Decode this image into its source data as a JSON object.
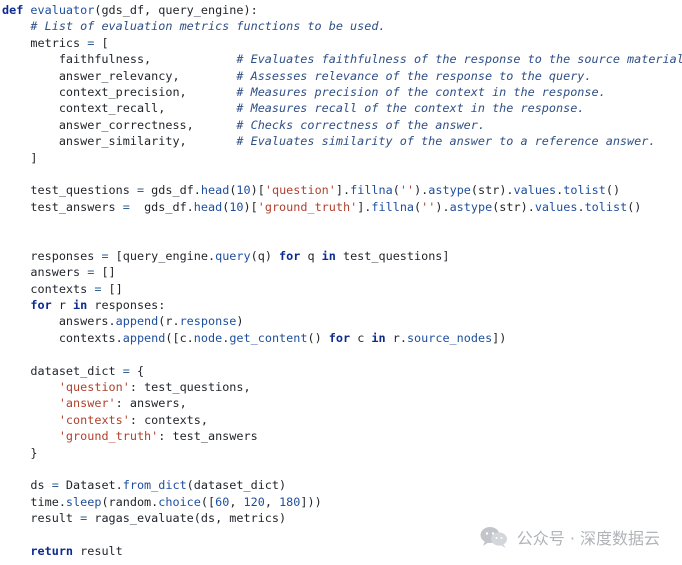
{
  "editor": {
    "lines": [
      [
        {
          "t": "def",
          "c": "kw"
        },
        {
          "t": " "
        },
        {
          "t": "evaluator",
          "c": "fn"
        },
        {
          "t": "(gds_df, query_engine):"
        }
      ],
      [
        {
          "t": "    "
        },
        {
          "t": "# List of evaluation metrics functions to be used.",
          "c": "cm"
        }
      ],
      [
        {
          "t": "    metrics "
        },
        {
          "t": "=",
          "c": "op"
        },
        {
          "t": " ["
        }
      ],
      [
        {
          "t": "        faithfulness,            "
        },
        {
          "t": "# Evaluates faithfulness of the response to the source material.",
          "c": "cm"
        }
      ],
      [
        {
          "t": "        answer_relevancy,        "
        },
        {
          "t": "# Assesses relevance of the response to the query.",
          "c": "cm"
        }
      ],
      [
        {
          "t": "        context_precision,       "
        },
        {
          "t": "# Measures precision of the context in the response.",
          "c": "cm"
        }
      ],
      [
        {
          "t": "        context_recall,          "
        },
        {
          "t": "# Measures recall of the context in the response.",
          "c": "cm"
        }
      ],
      [
        {
          "t": "        answer_correctness,      "
        },
        {
          "t": "# Checks correctness of the answer.",
          "c": "cm"
        }
      ],
      [
        {
          "t": "        answer_similarity,       "
        },
        {
          "t": "# Evaluates similarity of the answer to a reference answer.",
          "c": "cm"
        }
      ],
      [
        {
          "t": "    ]"
        }
      ],
      [
        {
          "t": ""
        }
      ],
      [
        {
          "t": "    test_questions "
        },
        {
          "t": "=",
          "c": "op"
        },
        {
          "t": " gds_df."
        },
        {
          "t": "head",
          "c": "fn"
        },
        {
          "t": "("
        },
        {
          "t": "10",
          "c": "num"
        },
        {
          "t": ")["
        },
        {
          "t": "'question'",
          "c": "str"
        },
        {
          "t": "]."
        },
        {
          "t": "fillna",
          "c": "fn"
        },
        {
          "t": "("
        },
        {
          "t": "''",
          "c": "str"
        },
        {
          "t": ")."
        },
        {
          "t": "astype",
          "c": "fn"
        },
        {
          "t": "(str)."
        },
        {
          "t": "values",
          "c": "fn"
        },
        {
          "t": "."
        },
        {
          "t": "tolist",
          "c": "fn"
        },
        {
          "t": "()"
        }
      ],
      [
        {
          "t": "    test_answers "
        },
        {
          "t": "=",
          "c": "op"
        },
        {
          "t": "  gds_df."
        },
        {
          "t": "head",
          "c": "fn"
        },
        {
          "t": "("
        },
        {
          "t": "10",
          "c": "num"
        },
        {
          "t": ")["
        },
        {
          "t": "'ground_truth'",
          "c": "str"
        },
        {
          "t": "]."
        },
        {
          "t": "fillna",
          "c": "fn"
        },
        {
          "t": "("
        },
        {
          "t": "''",
          "c": "str"
        },
        {
          "t": ")."
        },
        {
          "t": "astype",
          "c": "fn"
        },
        {
          "t": "(str)."
        },
        {
          "t": "values",
          "c": "fn"
        },
        {
          "t": "."
        },
        {
          "t": "tolist",
          "c": "fn"
        },
        {
          "t": "()"
        }
      ],
      [
        {
          "t": ""
        }
      ],
      [
        {
          "t": ""
        }
      ],
      [
        {
          "t": "    responses "
        },
        {
          "t": "=",
          "c": "op"
        },
        {
          "t": " [query_engine."
        },
        {
          "t": "query",
          "c": "fn"
        },
        {
          "t": "(q) "
        },
        {
          "t": "for",
          "c": "kw"
        },
        {
          "t": " q "
        },
        {
          "t": "in",
          "c": "kw"
        },
        {
          "t": " test_questions]"
        }
      ],
      [
        {
          "t": "    answers "
        },
        {
          "t": "=",
          "c": "op"
        },
        {
          "t": " []"
        }
      ],
      [
        {
          "t": "    contexts "
        },
        {
          "t": "=",
          "c": "op"
        },
        {
          "t": " []"
        }
      ],
      [
        {
          "t": "    "
        },
        {
          "t": "for",
          "c": "kw"
        },
        {
          "t": " r "
        },
        {
          "t": "in",
          "c": "kw"
        },
        {
          "t": " responses:"
        }
      ],
      [
        {
          "t": "        answers."
        },
        {
          "t": "append",
          "c": "fn"
        },
        {
          "t": "(r."
        },
        {
          "t": "response",
          "c": "fn"
        },
        {
          "t": ")"
        }
      ],
      [
        {
          "t": "        contexts."
        },
        {
          "t": "append",
          "c": "fn"
        },
        {
          "t": "([c."
        },
        {
          "t": "node",
          "c": "fn"
        },
        {
          "t": "."
        },
        {
          "t": "get_content",
          "c": "fn"
        },
        {
          "t": "() "
        },
        {
          "t": "for",
          "c": "kw"
        },
        {
          "t": " c "
        },
        {
          "t": "in",
          "c": "kw"
        },
        {
          "t": " r."
        },
        {
          "t": "source_nodes",
          "c": "fn"
        },
        {
          "t": "])"
        }
      ],
      [
        {
          "t": ""
        }
      ],
      [
        {
          "t": "    dataset_dict "
        },
        {
          "t": "=",
          "c": "op"
        },
        {
          "t": " {"
        }
      ],
      [
        {
          "t": "        "
        },
        {
          "t": "'question'",
          "c": "str"
        },
        {
          "t": ": test_questions,"
        }
      ],
      [
        {
          "t": "        "
        },
        {
          "t": "'answer'",
          "c": "str"
        },
        {
          "t": ": answers,"
        }
      ],
      [
        {
          "t": "        "
        },
        {
          "t": "'contexts'",
          "c": "str"
        },
        {
          "t": ": contexts,"
        }
      ],
      [
        {
          "t": "        "
        },
        {
          "t": "'ground_truth'",
          "c": "str"
        },
        {
          "t": ": test_answers"
        }
      ],
      [
        {
          "t": "    }"
        }
      ],
      [
        {
          "t": ""
        }
      ],
      [
        {
          "t": "    ds "
        },
        {
          "t": "=",
          "c": "op"
        },
        {
          "t": " Dataset."
        },
        {
          "t": "from_dict",
          "c": "fn"
        },
        {
          "t": "(dataset_dict)"
        }
      ],
      [
        {
          "t": "    time."
        },
        {
          "t": "sleep",
          "c": "fn"
        },
        {
          "t": "(random."
        },
        {
          "t": "choice",
          "c": "fn"
        },
        {
          "t": "(["
        },
        {
          "t": "60",
          "c": "num"
        },
        {
          "t": ", "
        },
        {
          "t": "120",
          "c": "num"
        },
        {
          "t": ", "
        },
        {
          "t": "180",
          "c": "num"
        },
        {
          "t": "]))"
        }
      ],
      [
        {
          "t": "    result "
        },
        {
          "t": "=",
          "c": "op"
        },
        {
          "t": " ragas_evaluate(ds, metrics)"
        }
      ],
      [
        {
          "t": ""
        }
      ],
      [
        {
          "t": "    "
        },
        {
          "t": "return",
          "c": "kw"
        },
        {
          "t": " result"
        }
      ]
    ]
  },
  "watermark": {
    "text": "公众号 · 深度数据云",
    "icon": "wechat-icon"
  },
  "colors": {
    "keyword": "#0b2b8f",
    "function": "#1d4e9e",
    "comment": "#2f4f86",
    "string": "#b1402c",
    "watermark": "#b0b3b8"
  }
}
